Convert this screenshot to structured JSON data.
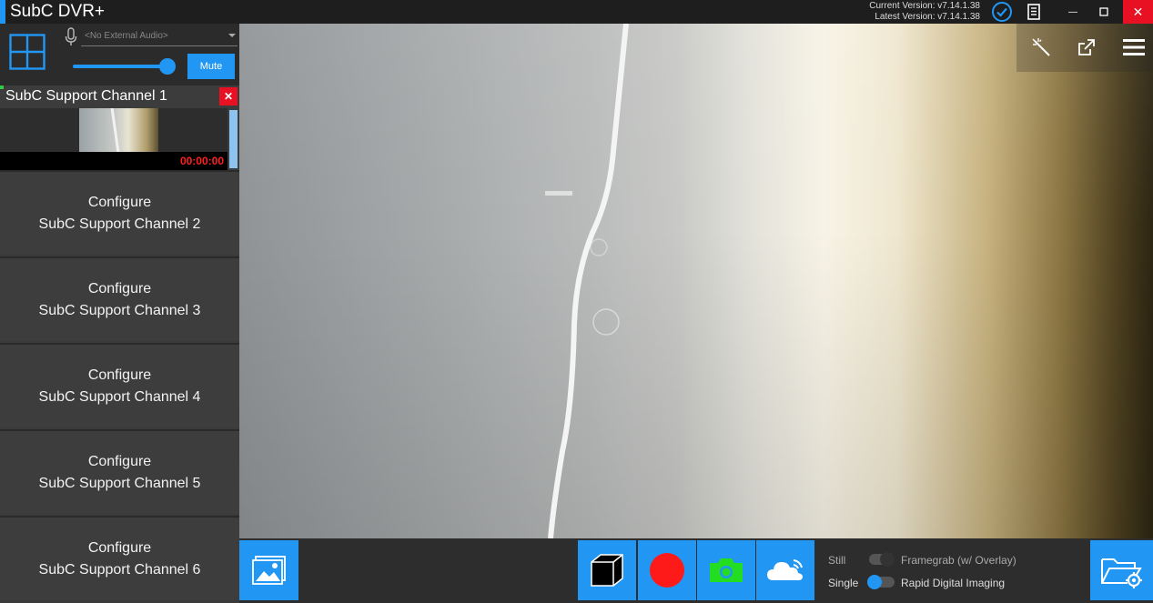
{
  "window": {
    "title": "SubC DVR+",
    "current_version": "Current Version: v7.14.1.38",
    "latest_version": "Latest Version: v7.14.1.38",
    "minimize_glyph": "—",
    "maximize_glyph": "▫",
    "close_glyph": "✕"
  },
  "audio": {
    "device_placeholder": "<No External Audio>",
    "volume_percent": 100,
    "mute_label": "Mute"
  },
  "channel1": {
    "title": "SubC Support Channel 1",
    "close_glyph": "✕",
    "timer": "00:00:00"
  },
  "channels": [
    {
      "line1": "Configure",
      "line2": "SubC Support Channel 2"
    },
    {
      "line1": "Configure",
      "line2": "SubC Support Channel 3"
    },
    {
      "line1": "Configure",
      "line2": "SubC Support Channel 4"
    },
    {
      "line1": "Configure",
      "line2": "SubC Support Channel 5"
    },
    {
      "line1": "Configure",
      "line2": "SubC Support Channel 6"
    }
  ],
  "capture": {
    "still_label": "Still",
    "framegrab_label": "Framegrab (w/ Overlay)",
    "single_label": "Single",
    "rdi_label": "Rapid Digital Imaging",
    "framegrab_on": false,
    "rdi_on": true
  },
  "colors": {
    "accent": "#2196f3",
    "record": "#ff1a1a",
    "snapshot": "#22dd22",
    "close": "#e81123",
    "timer": "#ff2020"
  },
  "icons": {
    "layout": "grid-icon",
    "mic": "microphone-icon",
    "status": "check-circle-icon",
    "log": "document-icon",
    "magic": "magic-wand-icon",
    "popout": "external-link-icon",
    "menu": "hamburger-menu-icon",
    "gallery": "image-gallery-icon",
    "overlay": "cube-icon",
    "record": "record-icon",
    "snapshot": "camera-icon",
    "cloud": "cloud-stream-icon",
    "folder": "folder-settings-icon"
  }
}
